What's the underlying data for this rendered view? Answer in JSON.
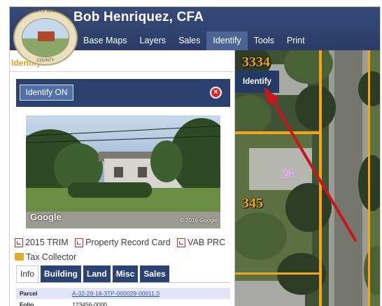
{
  "header": {
    "title": "Bob Henriquez,  CFA",
    "logo_ring_top": "PROPERTY APPRAISER",
    "logo_ring_bottom": "COUNTY",
    "nav": [
      {
        "label": "Base Maps"
      },
      {
        "label": "Layers"
      },
      {
        "label": "Sales"
      },
      {
        "label": "Identify"
      },
      {
        "label": "Tools"
      },
      {
        "label": "Print"
      }
    ]
  },
  "panel": {
    "title": "Identify",
    "toggle_label": "Identify ON",
    "close_glyph": "×",
    "photo": {
      "brand": "Google",
      "credit": "© 2016 Google"
    },
    "links": [
      {
        "label": "2015 TRIM",
        "icon": "pdf-icon"
      },
      {
        "label": "Property Record Card",
        "icon": "pdf-icon"
      },
      {
        "label": "VAB PRC",
        "icon": "pdf-icon"
      },
      {
        "label": "Tax Collector",
        "icon": "folder-icon"
      }
    ],
    "tabs": [
      {
        "label": "Info",
        "active": true
      },
      {
        "label": "Building",
        "active": false
      },
      {
        "label": "Land",
        "active": false
      },
      {
        "label": "Misc",
        "active": false
      },
      {
        "label": "Sales",
        "active": false
      }
    ],
    "rows": [
      {
        "key": "Parcel",
        "value": "A-32-29-18-3TP-000029-00011.0"
      },
      {
        "key": "Folio",
        "value": "123456-0000"
      }
    ]
  },
  "map": {
    "tooltip": "Identify",
    "parcel_labels": [
      "3334",
      "24",
      "345"
    ]
  },
  "colors": {
    "header_bg": "#2b3c67",
    "accent_orange": "#e89b1f",
    "parcel_line": "#f5a41d",
    "annotation_arrow": "#c8161d"
  }
}
